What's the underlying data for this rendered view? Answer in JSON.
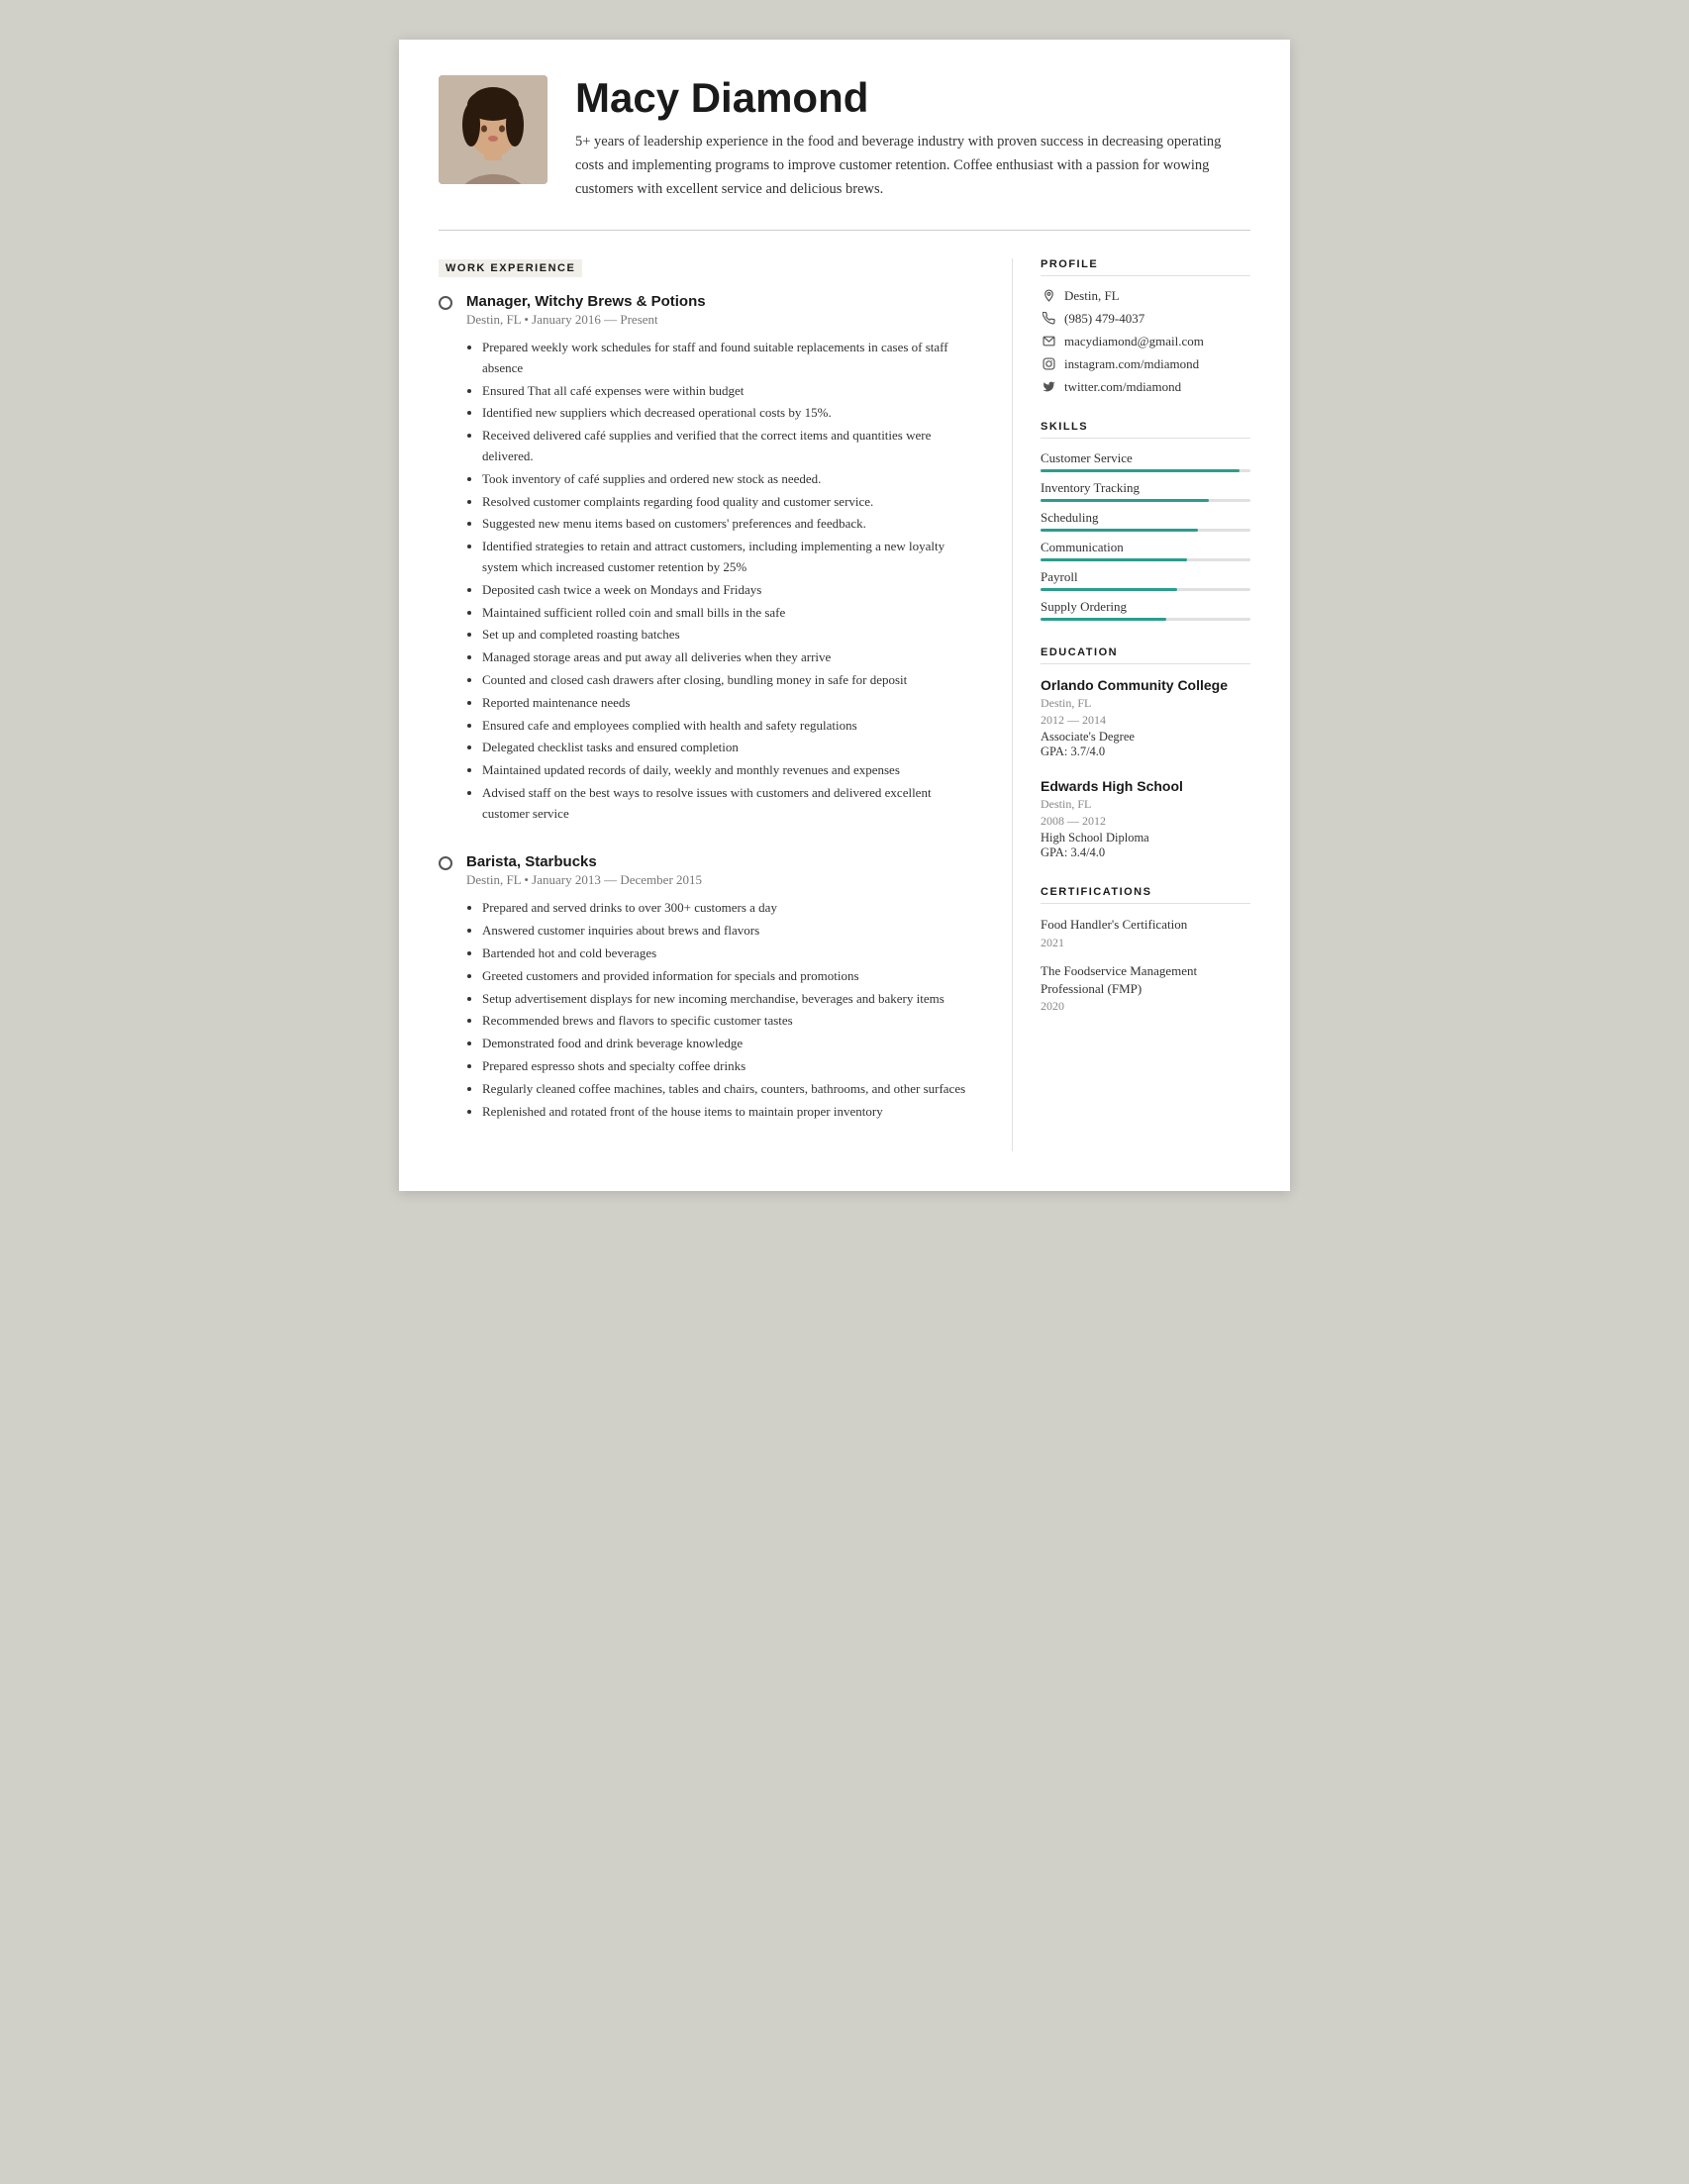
{
  "header": {
    "name": "Macy Diamond",
    "summary": "5+ years of leadership experience in the food and beverage industry with proven success in decreasing operating costs and implementing programs to improve customer retention. Coffee enthusiast with a passion for wowing customers with excellent service and delicious brews.",
    "avatar_alt": "Macy Diamond headshot"
  },
  "work_experience": {
    "section_label": "WORK EXPERIENCE",
    "jobs": [
      {
        "title": "Manager, Witchy Brews & Potions",
        "meta": "Destin, FL • January 2016 — Present",
        "bullets": [
          "Prepared weekly work schedules for staff and found suitable replacements in cases of staff absence",
          "Ensured That all café expenses were within budget",
          "Identified new suppliers which decreased operational costs by 15%.",
          "Received delivered café supplies and verified that the correct items and quantities were delivered.",
          "Took inventory of café supplies and ordered new stock as needed.",
          "Resolved customer complaints regarding food quality and customer service.",
          "Suggested new menu items based on customers' preferences and feedback.",
          "Identified strategies to retain and attract customers, including implementing a new loyalty system which increased customer retention by 25%",
          "Deposited cash twice a week on Mondays and Fridays",
          "Maintained sufficient rolled coin and small bills in the safe",
          "Set up and completed roasting batches",
          "Managed storage areas and put away all deliveries when they arrive",
          "Counted and closed cash drawers after closing, bundling money in safe for deposit",
          "Reported maintenance needs",
          "Ensured cafe and employees complied with health and safety regulations",
          "Delegated checklist tasks and ensured completion",
          "Maintained updated records of daily, weekly and monthly revenues and expenses",
          "Advised staff on the best ways to resolve issues with customers and delivered excellent customer service"
        ]
      },
      {
        "title": "Barista, Starbucks",
        "meta": "Destin, FL • January 2013 — December 2015",
        "bullets": [
          "Prepared and served drinks to over 300+ customers a day",
          "Answered customer inquiries about brews and flavors",
          "Bartended hot and cold beverages",
          "Greeted customers and provided information for specials and promotions",
          "Setup advertisement displays for new incoming merchandise, beverages and bakery items",
          "Recommended brews and flavors to specific customer tastes",
          "Demonstrated food and drink beverage knowledge",
          "Prepared espresso shots and specialty coffee drinks",
          "Regularly cleaned coffee machines, tables and chairs, counters, bathrooms, and other surfaces",
          "Replenished and rotated front of the house items to maintain proper inventory"
        ]
      }
    ]
  },
  "profile": {
    "section_label": "PROFILE",
    "items": [
      {
        "icon": "location-icon",
        "text": "Destin, FL"
      },
      {
        "icon": "phone-icon",
        "text": "(985) 479-4037"
      },
      {
        "icon": "email-icon",
        "text": "macydiamond@gmail.com"
      },
      {
        "icon": "instagram-icon",
        "text": "instagram.com/mdiamond"
      },
      {
        "icon": "twitter-icon",
        "text": "twitter.com/mdiamond"
      }
    ]
  },
  "skills": {
    "section_label": "SKILLS",
    "items": [
      {
        "name": "Customer Service",
        "pct": 95
      },
      {
        "name": "Inventory Tracking",
        "pct": 80
      },
      {
        "name": "Scheduling",
        "pct": 75
      },
      {
        "name": "Communication",
        "pct": 70
      },
      {
        "name": "Payroll",
        "pct": 65
      },
      {
        "name": "Supply Ordering",
        "pct": 60
      }
    ]
  },
  "education": {
    "section_label": "EDUCATION",
    "entries": [
      {
        "school": "Orlando Community College",
        "meta1": "Destin, FL",
        "meta2": "2012 — 2014",
        "degree": "Associate's Degree",
        "gpa": "GPA: 3.7/4.0"
      },
      {
        "school": "Edwards High School",
        "meta1": "Destin, FL",
        "meta2": "2008 — 2012",
        "degree": "High School Diploma",
        "gpa": "GPA: 3.4/4.0"
      }
    ]
  },
  "certifications": {
    "section_label": "CERTIFICATIONS",
    "entries": [
      {
        "name": "Food Handler's Certification",
        "year": "2021"
      },
      {
        "name": "The Foodservice Management Professional (FMP)",
        "year": "2020"
      }
    ]
  }
}
